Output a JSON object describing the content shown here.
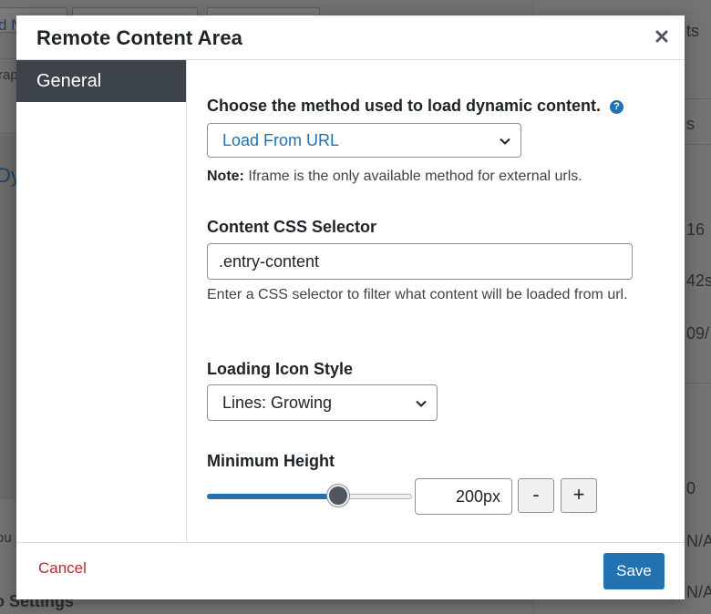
{
  "background": {
    "fragments": [
      "d N",
      "rap",
      "Dy",
      "ou",
      "o Settings",
      "ts",
      "s",
      "16",
      "42s",
      "09/",
      "0",
      "N/A",
      "N/A"
    ]
  },
  "modal": {
    "title": "Remote Content Area",
    "close_icon": "close-icon",
    "sidebar": {
      "items": [
        {
          "label": "General",
          "active": true
        }
      ]
    },
    "fields": {
      "method": {
        "label": "Choose the method used to load dynamic content.",
        "help_icon": "?",
        "selected": "Load From URL",
        "note_prefix": "Note:",
        "note_text": " Iframe is the only available method for external urls."
      },
      "selector": {
        "label": "Content CSS Selector",
        "value": ".entry-content",
        "help": "Enter a CSS selector to filter what content will be loaded from url."
      },
      "icon_style": {
        "label": "Loading Icon Style",
        "selected": "Lines: Growing"
      },
      "min_height": {
        "label": "Minimum Height",
        "value": "200px",
        "slider_fraction": 0.64,
        "minus": "-",
        "plus": "+"
      }
    },
    "footer": {
      "cancel": "Cancel",
      "save": "Save"
    }
  },
  "colors": {
    "accent": "#2271b1",
    "danger": "#b32d2e",
    "nav_active_bg": "#3c434a"
  }
}
